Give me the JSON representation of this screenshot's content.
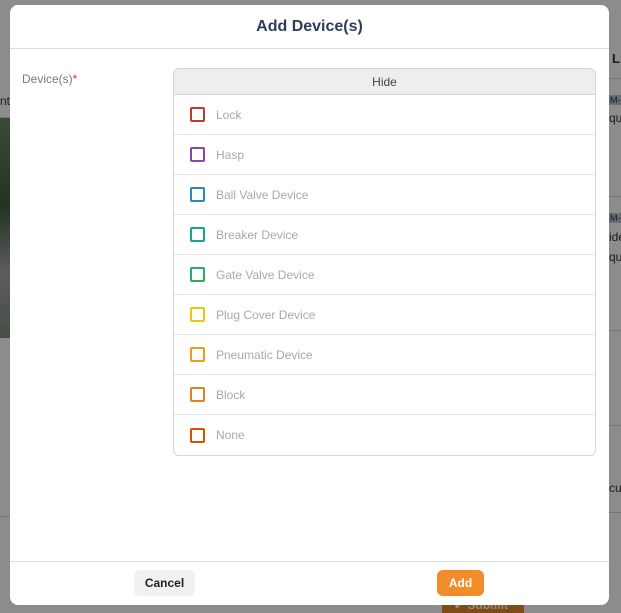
{
  "modal": {
    "title": "Add Device(s)",
    "field_label": "Device(s)",
    "required_marker": "*",
    "panel_toggle": "Hide",
    "devices": [
      {
        "label": "Lock",
        "color": "#c0392b"
      },
      {
        "label": "Hasp",
        "color": "#8e44ad"
      },
      {
        "label": "Ball Valve Device",
        "color": "#2e86c1"
      },
      {
        "label": "Breaker Device",
        "color": "#17a589"
      },
      {
        "label": "Gate Valve Device",
        "color": "#27ae60"
      },
      {
        "label": "Plug Cover Device",
        "color": "#f1c40f"
      },
      {
        "label": "Pneumatic Device",
        "color": "#f39c12"
      },
      {
        "label": "Block",
        "color": "#e67e22"
      },
      {
        "label": "None",
        "color": "#d35400"
      }
    ],
    "footer": {
      "cancel_label": "Cancel",
      "add_label": "Add"
    }
  },
  "background": {
    "column_header_fragment": "L",
    "row_text_fragment_1": "nt",
    "tag_fragment_1": "M-",
    "text_fragment_qu_1": "qu",
    "tag_fragment_2": "M-",
    "text_fragment_ide": "ide",
    "text_fragment_qu_2": "qu",
    "text_fragment_cu": "cu",
    "submit_label": "Submit"
  }
}
